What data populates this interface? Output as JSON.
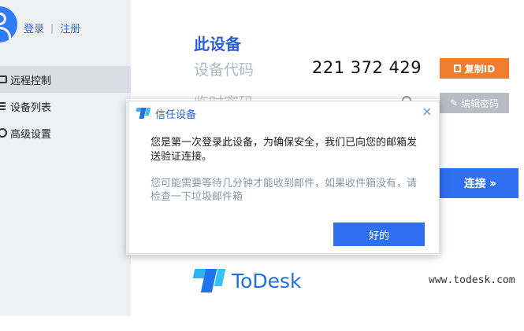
{
  "sidebar": {
    "login_label": "登录",
    "separator": "|",
    "register_label": "注册",
    "items": [
      {
        "label": "远程控制",
        "icon": "monitor-icon",
        "active": true
      },
      {
        "label": "设备列表",
        "icon": "list-icon",
        "active": false
      },
      {
        "label": "高级设置",
        "icon": "gear-icon",
        "active": false
      }
    ]
  },
  "main": {
    "section_title": "此设备",
    "device_code_label": "设备代码",
    "device_code": "221 372 429",
    "copy_id_label": "复制ID",
    "temp_password_label": "临时密码",
    "edit_password_label": "编辑密码",
    "connect_label": "连接",
    "logo_text": "ToDesk",
    "website": "www.todesk.com"
  },
  "dialog": {
    "title": "信任设备",
    "close_glyph": "×",
    "message": "您是第一次登录此设备，为确保安全，我们已向您的邮箱发送验证连接。",
    "hint": "您可能需要等待几分钟才能收到邮件，如果收件箱没有，请检查一下垃圾邮件箱",
    "ok_label": "好的"
  },
  "colors": {
    "accent_blue": "#2f6ff0",
    "orange": "#f07d2e",
    "sidebar_bg": "#eef0f4"
  }
}
